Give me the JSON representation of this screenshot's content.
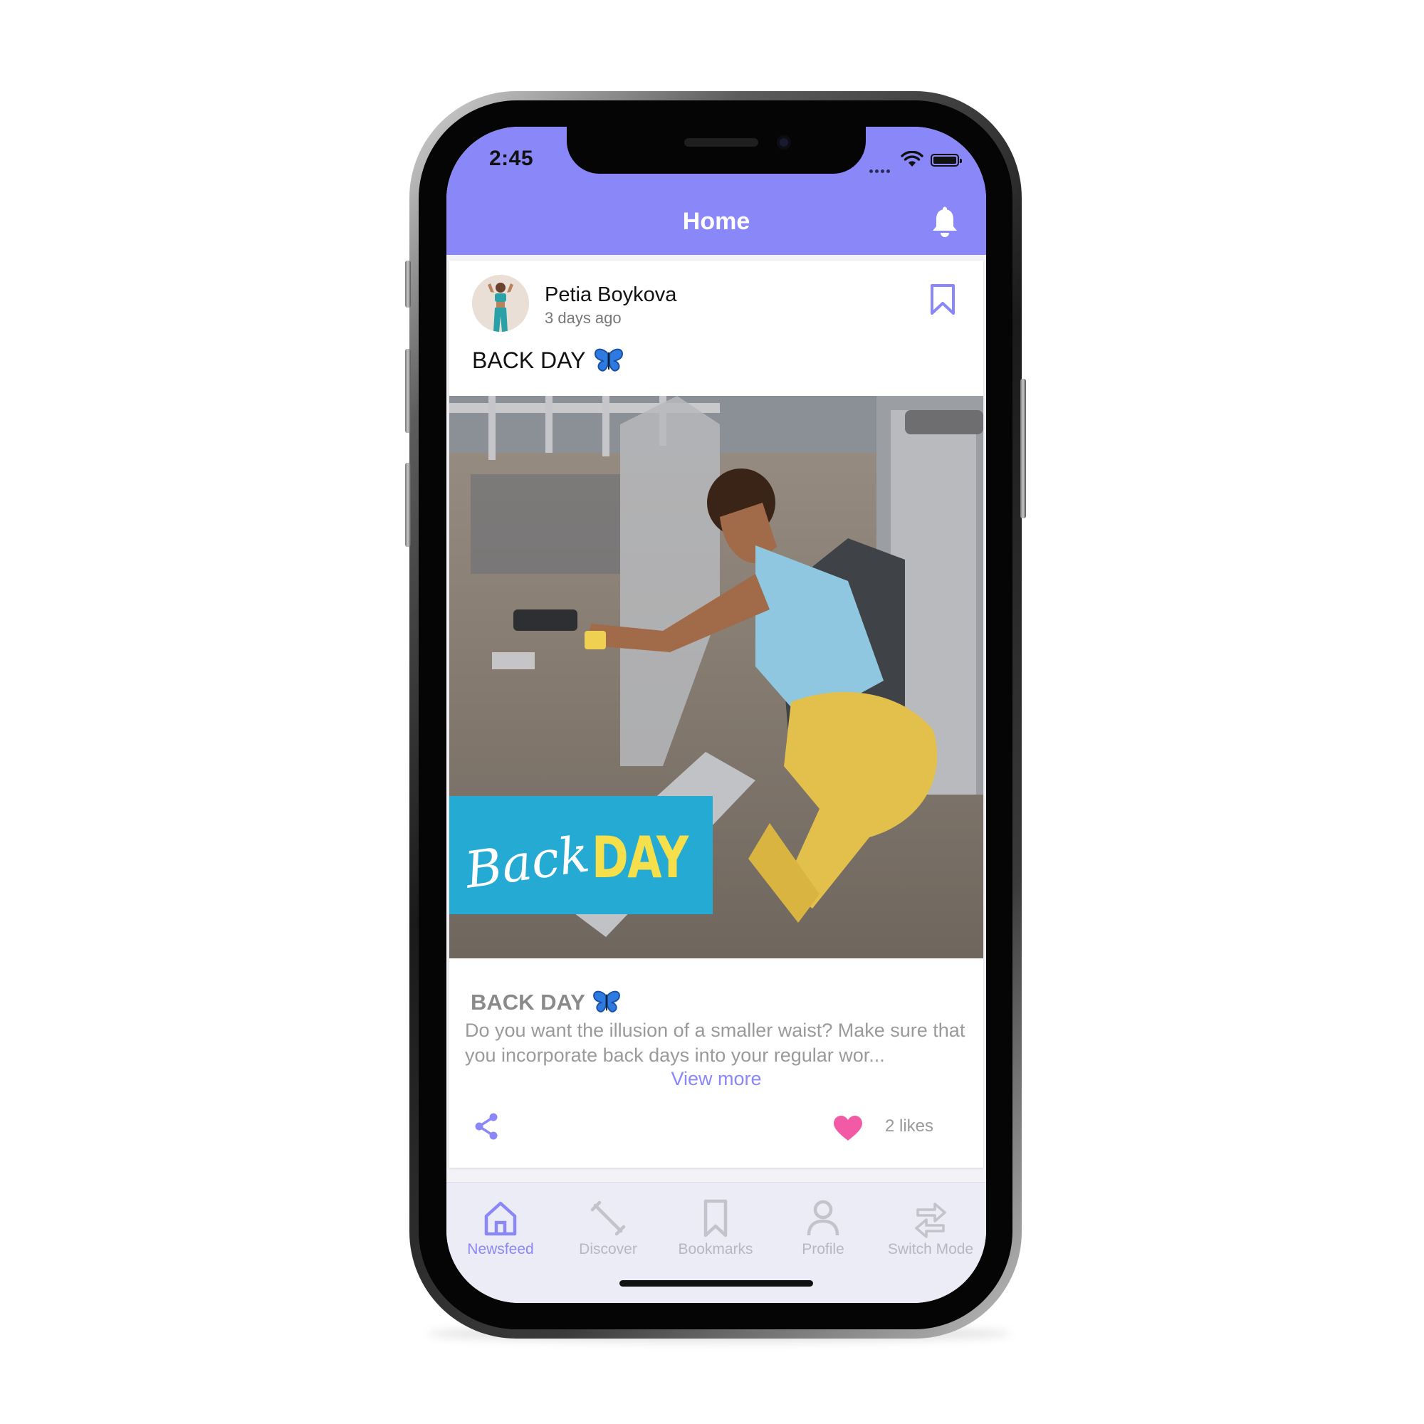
{
  "status_bar": {
    "time": "2:45"
  },
  "header": {
    "title": "Home"
  },
  "post": {
    "author_name": "Petia Boykova",
    "time_ago": "3 days ago",
    "title": "BACK DAY",
    "image_text": {
      "script_word": "Back",
      "bold_word": "DAY"
    },
    "body_title": "BACK DAY",
    "body_text": "Do you want the illusion of a smaller waist? Make sure that you incorporate back days into your regular wor...",
    "view_more_label": "View more",
    "likes_label": "2 likes"
  },
  "tabs": [
    {
      "label": "Newsfeed",
      "icon": "home-icon"
    },
    {
      "label": "Discover",
      "icon": "dumbbell-icon"
    },
    {
      "label": "Bookmarks",
      "icon": "bookmark-icon"
    },
    {
      "label": "Profile",
      "icon": "person-icon"
    },
    {
      "label": "Switch Mode",
      "icon": "switch-arrows-icon"
    }
  ],
  "colors": {
    "accent": "#8a87f8",
    "like": "#f25aa5",
    "banner": "#25aad3",
    "banner_text": "#f5e04c"
  }
}
